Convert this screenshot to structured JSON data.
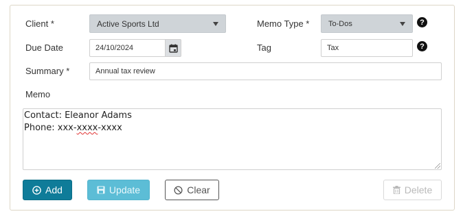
{
  "form": {
    "client": {
      "label": "Client *",
      "value": "Active Sports Ltd"
    },
    "memo_type": {
      "label": "Memo Type *",
      "value": "To-Dos"
    },
    "due_date": {
      "label": "Due Date",
      "value": "24/10/2024"
    },
    "tag": {
      "label": "Tag",
      "value": "Tax"
    },
    "summary": {
      "label": "Summary *",
      "value": "Annual tax review"
    },
    "memo": {
      "label": "Memo",
      "line1": "Contact: Eleanor Adams",
      "line2_prefix": "Phone: xxx-",
      "line2_misspelled": "xxxx",
      "line2_suffix": "-xxxx"
    },
    "help_glyph": "?"
  },
  "actions": {
    "add": {
      "label": "Add",
      "icon": "plus-circle-icon"
    },
    "update": {
      "label": "Update",
      "icon": "save-icon"
    },
    "clear": {
      "label": "Clear",
      "icon": "ban-icon"
    },
    "delete": {
      "label": "Delete",
      "icon": "trash-icon"
    }
  },
  "colors": {
    "add": "#0f7c99",
    "update": "#5cbdd6",
    "select_bg": "#cfd4d8",
    "panel_border": "#ddd6c6",
    "misspelling": "#e03030"
  }
}
